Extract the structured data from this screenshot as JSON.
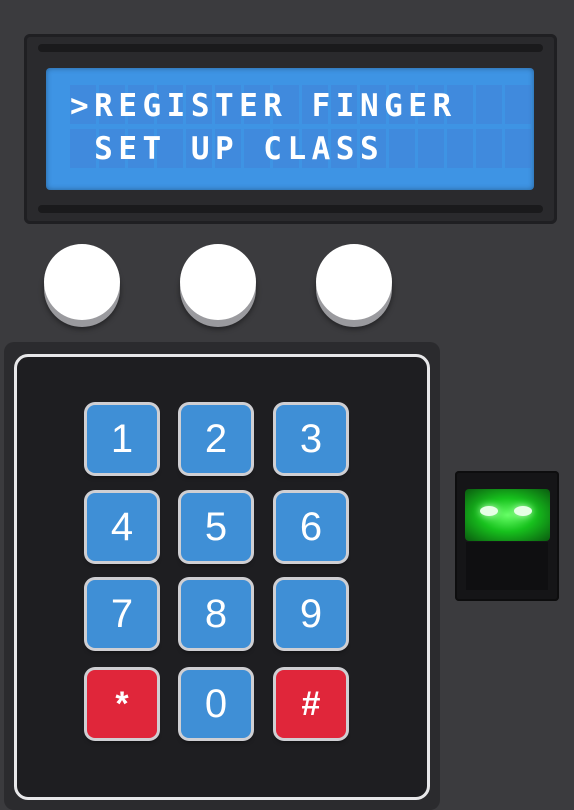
{
  "lcd": {
    "line1": ">REGISTER FINGER",
    "line2": " SET UP CLASS",
    "backlight_color": "#3e94e4",
    "text_color": "#ffffff"
  },
  "buttons": [
    {
      "name": "button-1"
    },
    {
      "name": "button-2"
    },
    {
      "name": "button-3"
    }
  ],
  "keypad": {
    "keys": [
      "1",
      "2",
      "3",
      "4",
      "5",
      "6",
      "7",
      "8",
      "9",
      "*",
      "0",
      "#"
    ],
    "key_color": "#3f8fd6",
    "special_key_color": "#e0263a"
  },
  "fingerprint_sensor": {
    "status_led_color": "#17c21d",
    "icon": "fingerprint-sensor-icon"
  }
}
